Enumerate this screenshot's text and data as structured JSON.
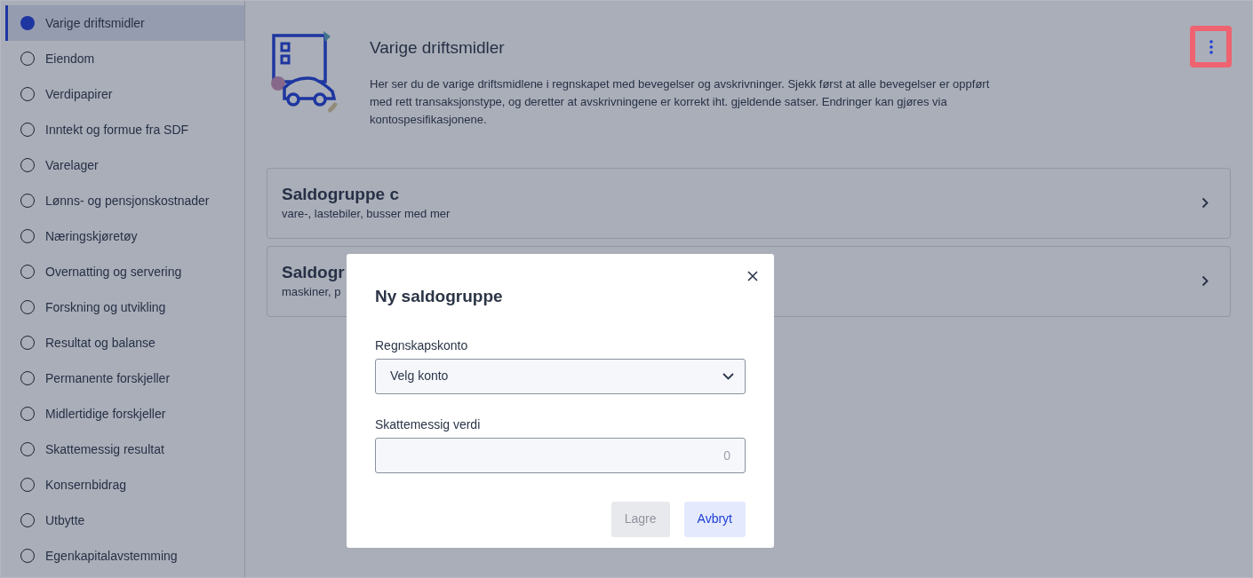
{
  "sidebar": {
    "items": [
      {
        "label": "Varige driftsmidler",
        "selected": true
      },
      {
        "label": "Eiendom",
        "selected": false
      },
      {
        "label": "Verdipapirer",
        "selected": false
      },
      {
        "label": "Inntekt og formue fra SDF",
        "selected": false
      },
      {
        "label": "Varelager",
        "selected": false
      },
      {
        "label": "Lønns- og pensjonskostnader",
        "selected": false
      },
      {
        "label": "Næringskjøretøy",
        "selected": false
      },
      {
        "label": "Overnatting og servering",
        "selected": false
      },
      {
        "label": "Forskning og utvikling",
        "selected": false
      },
      {
        "label": "Resultat og balanse",
        "selected": false
      },
      {
        "label": "Permanente forskjeller",
        "selected": false
      },
      {
        "label": "Midlertidige forskjeller",
        "selected": false
      },
      {
        "label": "Skattemessig resultat",
        "selected": false
      },
      {
        "label": "Konsernbidrag",
        "selected": false
      },
      {
        "label": "Utbytte",
        "selected": false
      },
      {
        "label": "Egenkapitalavstemming",
        "selected": false
      }
    ]
  },
  "header": {
    "title": "Varige driftsmidler",
    "description": "Her ser du de varige driftsmidlene i regnskapet med bevegelser og avskrivninger. Sjekk først at alle bevegelser er oppført med rett transaksjonstype, og deretter at avskrivningene er korrekt iht. gjeldende satser. Endringer kan gjøres via kontospesifikasjonene."
  },
  "groups": [
    {
      "title": "Saldogruppe c",
      "subtitle": "vare-, lastebiler, busser med mer"
    },
    {
      "title": "Saldogr",
      "subtitle": "maskiner, p"
    }
  ],
  "dialog": {
    "title": "Ny saldogruppe",
    "fields": [
      {
        "kind": "select",
        "label": "Regnskapskonto",
        "value": "Velg konto"
      },
      {
        "kind": "number",
        "label": "Skattemessig verdi",
        "placeholder": "0"
      }
    ],
    "buttons": [
      {
        "label": "Lagre",
        "disabled": true
      },
      {
        "label": "Avbryt",
        "disabled": false
      }
    ]
  }
}
